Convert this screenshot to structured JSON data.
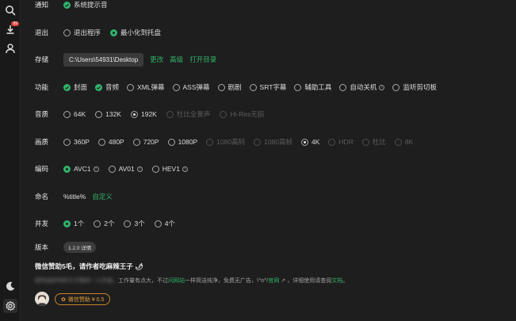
{
  "sidebar": {
    "search_icon": "search-icon",
    "download_icon": "download-icon",
    "download_badge": "99",
    "user_icon": "user-icon",
    "theme_icon": "moon-icon",
    "settings_icon": "gear-icon"
  },
  "notify": {
    "label": "通知",
    "option": "系统提示音"
  },
  "exit": {
    "label": "退出",
    "options": [
      "退出程序",
      "最小化到托盘"
    ]
  },
  "storage": {
    "label": "存储",
    "path": "C:\\Users\\54931\\Desktop",
    "links": [
      "更改",
      "高级",
      "打开目录"
    ]
  },
  "features": {
    "label": "功能",
    "options": [
      "封面",
      "音频",
      "XML弹幕",
      "ASS弹幕",
      "剧剧",
      "SRT字幕",
      "辅助工具",
      "自动关机",
      "监听剪切板"
    ]
  },
  "audio": {
    "label": "音质",
    "options": [
      "64K",
      "132K",
      "192K",
      "杜比全景声",
      "Hi-Res无损"
    ]
  },
  "video": {
    "label": "画质",
    "options": [
      "360P",
      "480P",
      "720P",
      "1080P",
      "1080高码",
      "1080高帧",
      "4K",
      "HDR",
      "杜比",
      "8K"
    ]
  },
  "codec": {
    "label": "编码",
    "options": [
      "AVC1",
      "AV01",
      "HEV1"
    ]
  },
  "naming": {
    "label": "命名",
    "value": "%title%",
    "custom": "自定义"
  },
  "concurrency": {
    "label": "并发",
    "options": [
      "1个",
      "2个",
      "3个",
      "4个"
    ]
  },
  "version": {
    "label": "版本",
    "badge": "1.2.0 详情"
  },
  "donate": {
    "title": "微信赞助5毛，请作者吃麻辣王子 🌶",
    "blur_text": "软件由轩年轩王子陪伴一人开发，",
    "line_text": "工作量有点大，不过",
    "line_link1": "问网站",
    "line_mid": "一样简洁纯净，免费无广告，\\^o^/",
    "line_link2": "官网",
    "line_end": "，详细使用请查阅",
    "line_link3": "文档",
    "button": "微信赞助 ¥ 0.5"
  },
  "colors": {
    "accent": "#2fb36b",
    "background": "#1e1e1e",
    "donate": "#e59a3a"
  }
}
